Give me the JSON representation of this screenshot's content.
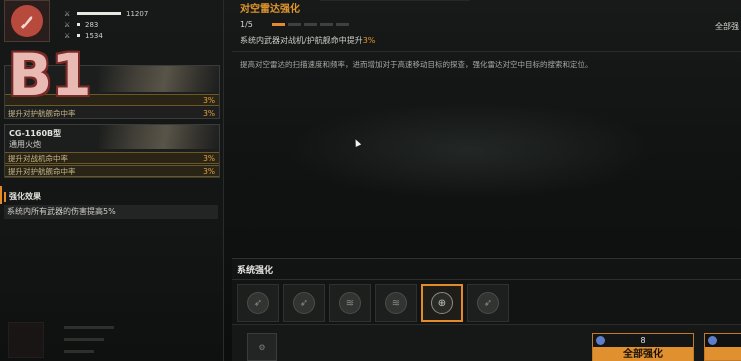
{
  "weapon": {
    "name": "",
    "stats": [
      {
        "icon": "gun-stat-icon",
        "value": "11207"
      },
      {
        "icon": "gun-stat-icon",
        "value": "283"
      },
      {
        "icon": "gun-stat-icon",
        "value": "1534"
      }
    ]
  },
  "overlay_badge": "B1",
  "cards": [
    {
      "title": "",
      "subtitle": "",
      "rows": [
        {
          "label": "",
          "value": "3%"
        },
        {
          "label": "提升对护航舰命中率",
          "value": "3%"
        }
      ]
    },
    {
      "title": "CG-1160B型",
      "subtitle": "通用火炮",
      "rows": [
        {
          "label": "提升对战机命中率",
          "value": "3%"
        },
        {
          "label": "提升对护航舰命中率",
          "value": "3%"
        }
      ]
    }
  ],
  "enhance_effect": {
    "heading": "强化效果",
    "text": "系统内所有武器的伤害提高5%"
  },
  "detail": {
    "title": "对空雷达强化",
    "level_text": "1/5",
    "level_current": 1,
    "level_max": 5,
    "all_label": "全部强",
    "effect_prefix": "系统内武器对战机/护航舰命中提升",
    "effect_value": "3%",
    "description": "提高对空雷达的扫描速度和频率，进而增加对于高速移动目标的探查，强化雷达对空中目标的搜索和定位。"
  },
  "system_panel": {
    "title": "系统强化",
    "slots": [
      {
        "icon": "missile-icon",
        "active": false
      },
      {
        "icon": "missile-icon",
        "active": false
      },
      {
        "icon": "heat-icon",
        "active": false
      },
      {
        "icon": "heat-icon",
        "active": false
      },
      {
        "icon": "radar-target-icon",
        "active": true
      },
      {
        "icon": "missile-icon",
        "active": false
      }
    ],
    "enhance_all_button": {
      "cost": "8",
      "label": "全部强化"
    }
  },
  "colors": {
    "accent": "#e48a2a",
    "highlight_text": "#e2962e",
    "badge": "#e9b9b3"
  }
}
